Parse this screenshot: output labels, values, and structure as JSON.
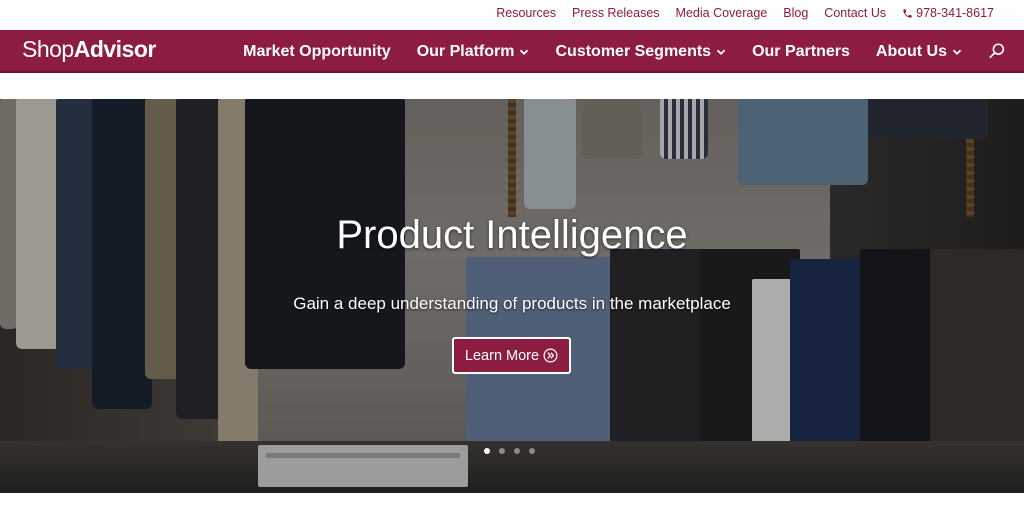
{
  "topbar": {
    "links": [
      "Resources",
      "Press Releases",
      "Media Coverage",
      "Blog",
      "Contact Us"
    ],
    "phone": "978-341-8617"
  },
  "brand": {
    "logo_light": "Shop",
    "logo_bold": "Advisor"
  },
  "nav": {
    "items": [
      {
        "label": "Market Opportunity",
        "has_dropdown": false
      },
      {
        "label": "Our Platform",
        "has_dropdown": true
      },
      {
        "label": "Customer Segments",
        "has_dropdown": true
      },
      {
        "label": "Our Partners",
        "has_dropdown": false
      },
      {
        "label": "About Us",
        "has_dropdown": true
      }
    ],
    "search_icon": "search-icon"
  },
  "hero": {
    "title": "Product Intelligence",
    "subtitle": "Gain a deep understanding of products in the marketplace",
    "button_label": "Learn More",
    "slides_count": 4,
    "active_slide": 1
  },
  "colors": {
    "brand": "#8c1d40",
    "nav_text": "#ffffff",
    "topbar_text": "#8c1d40"
  }
}
